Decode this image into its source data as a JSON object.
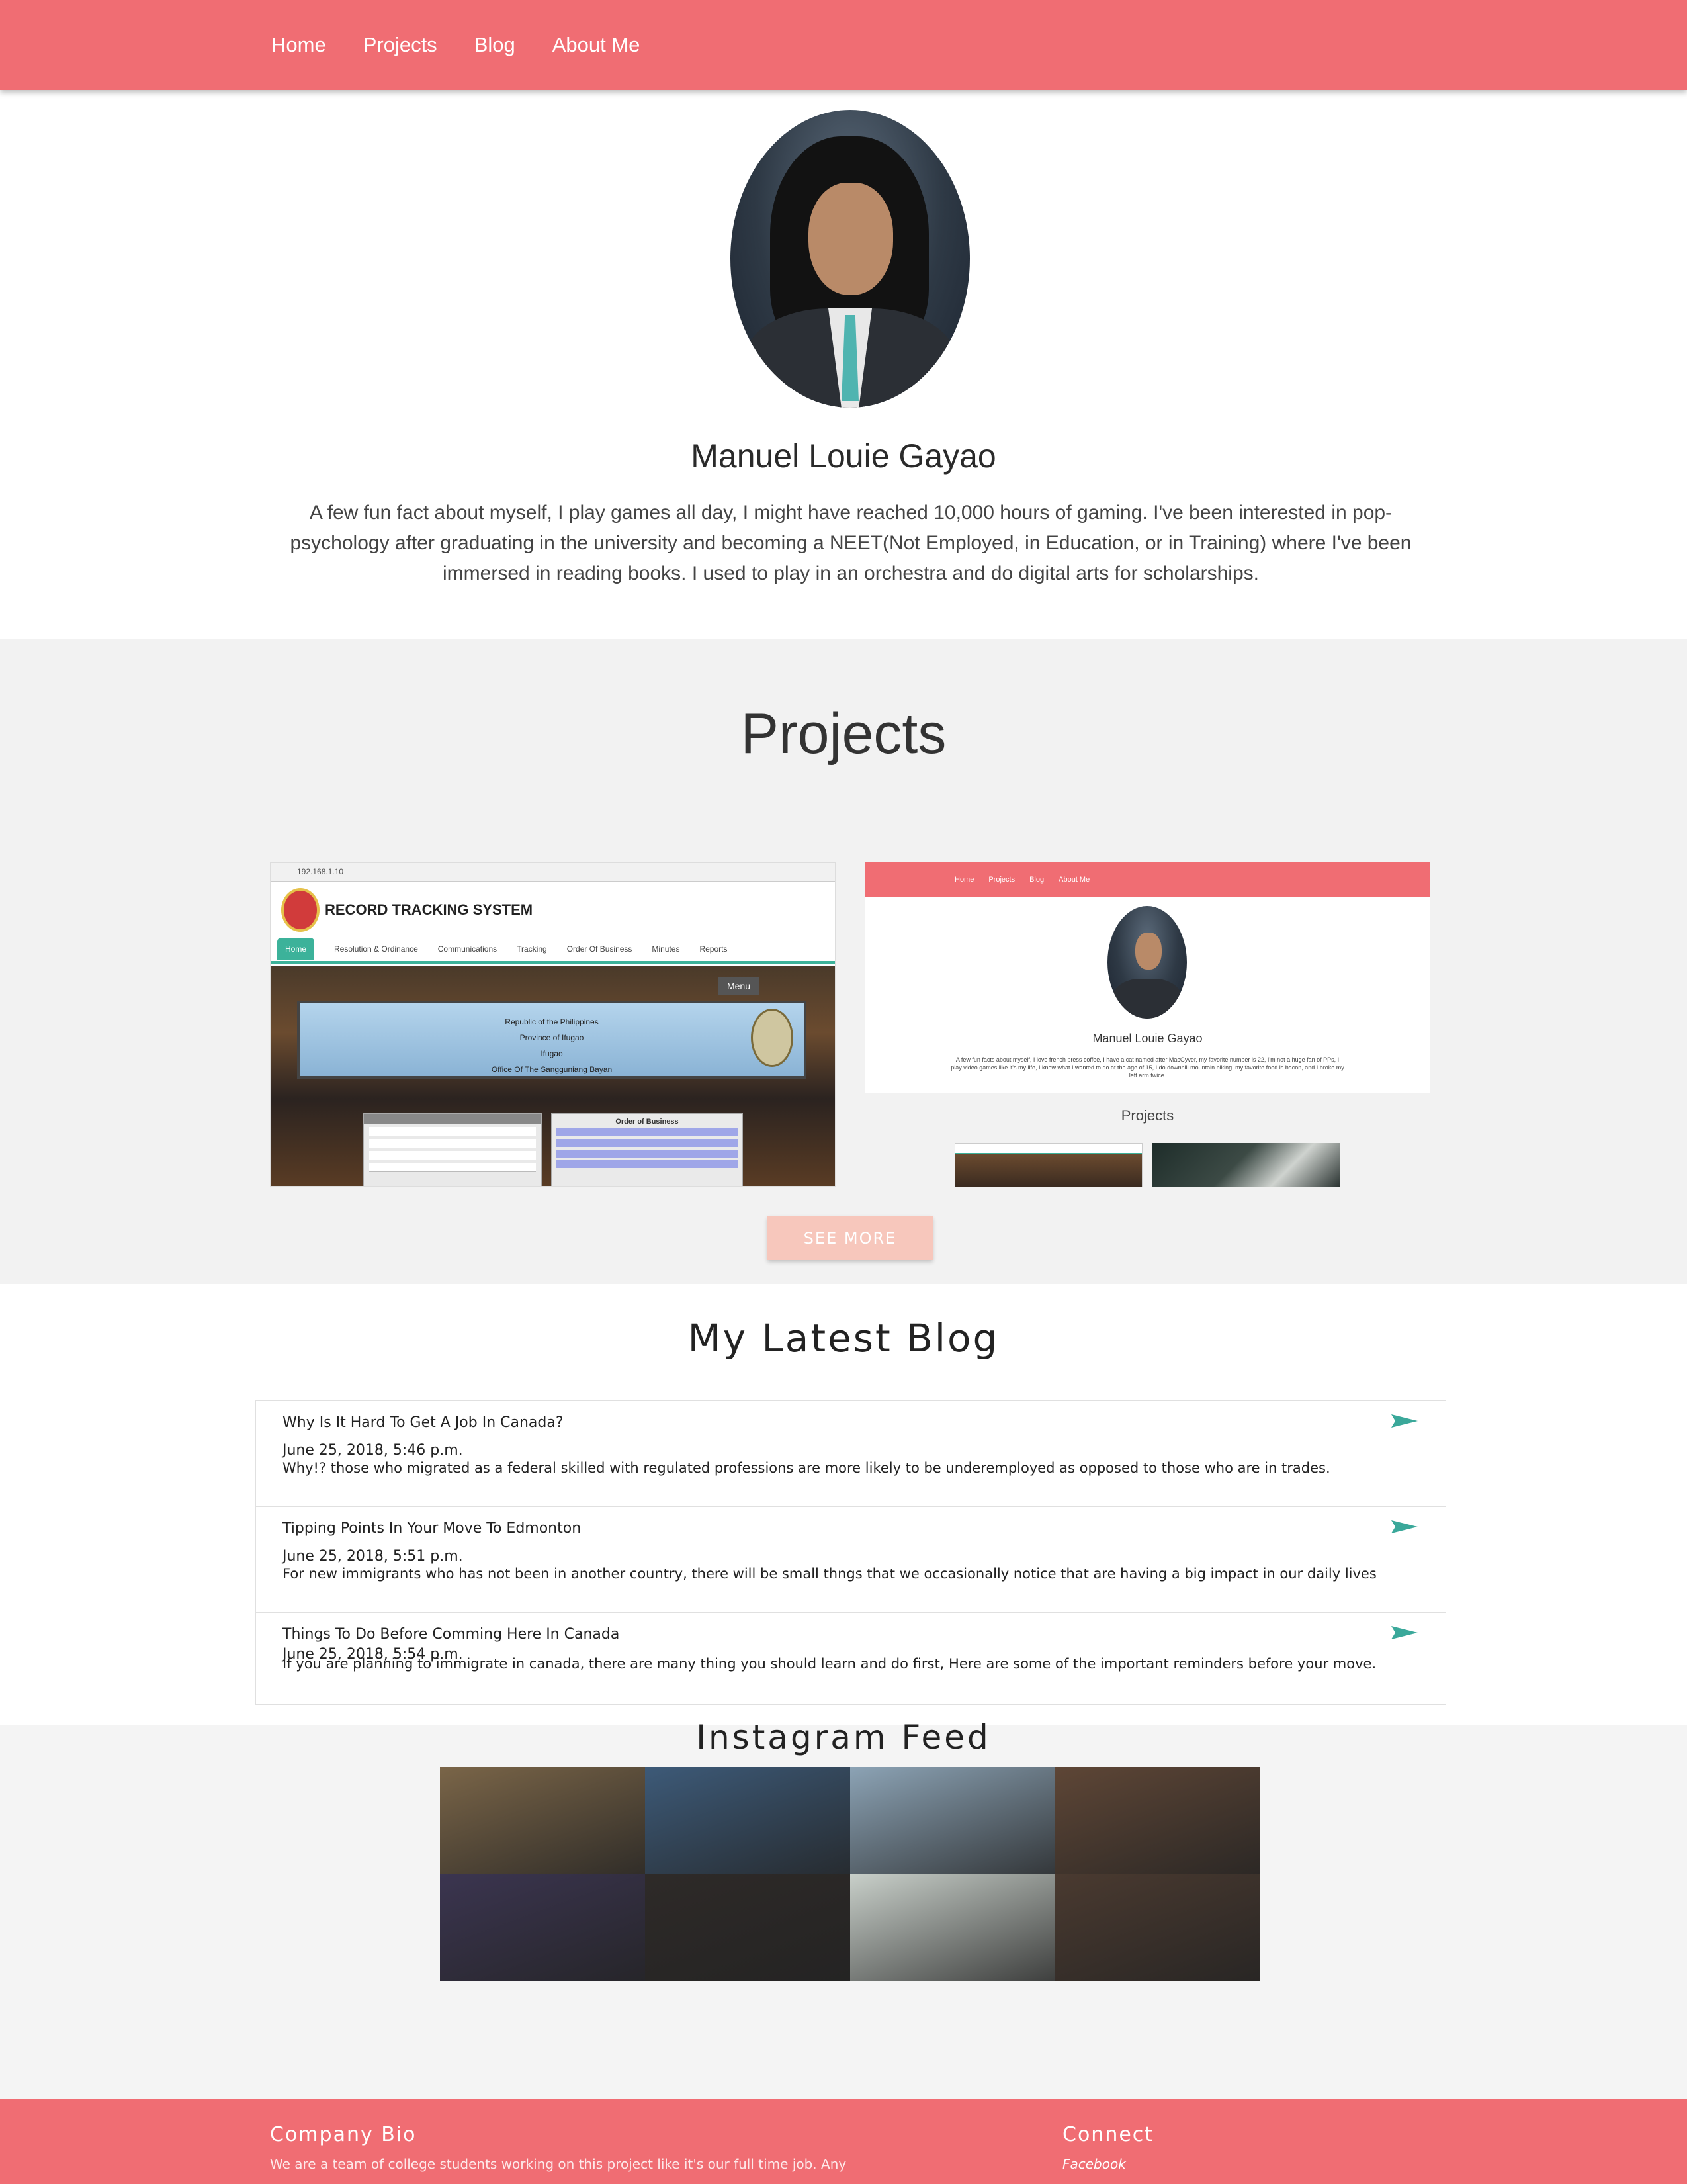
{
  "nav": {
    "items": [
      "Home",
      "Projects",
      "Blog",
      "About Me"
    ]
  },
  "profile": {
    "name": "Manuel Louie Gayao",
    "bio": "A few fun fact about myself, I play games all day, I might have reached 10,000 hours of gaming. I've been interested in pop-psychology after graduating in the university and becoming a NEET(Not Employed, in Education, or in Training) where I've been immersed in reading books. I used to play in an orchestra and do digital arts for scholarships."
  },
  "projects": {
    "title": "Projects",
    "card1": {
      "address": "192.168.1.10",
      "app_title": "RECORD TRACKING SYSTEM",
      "tabs": [
        "Home",
        "Resolution & Ordinance",
        "Communications",
        "Tracking",
        "Order Of Business",
        "Minutes",
        "Reports"
      ],
      "menu_label": "Menu",
      "banner_lines": [
        "Republic of the Philippines",
        "Province of Ifugao",
        "Ifugao",
        "Office Of The Sangguniang Bayan"
      ],
      "table_title": "Order of Business"
    },
    "card2": {
      "nav": [
        "Home",
        "Projects",
        "Blog",
        "About Me"
      ],
      "name": "Manuel Louie Gayao",
      "bio": "A few fun facts about myself, I love french press coffee, I have a cat named after MacGyver, my favorite number is 22, I'm not a huge fan of PPs, I play video games like it's my life, I knew what I wanted to do at the age of 15, I do downhill mountain biking, my favorite food is bacon, and I broke my left arm twice.",
      "section_label": "Projects"
    },
    "see_more": "SEE MORE"
  },
  "blog": {
    "title": "My Latest Blog",
    "posts": [
      {
        "title": "Why Is It Hard To Get A Job In Canada?",
        "date": "June 25, 2018, 5:46 p.m.",
        "excerpt": "Why!? those who migrated as a federal skilled with regulated professions are more likely to be underemployed as opposed to those who are in trades."
      },
      {
        "title": "Tipping Points In Your Move To Edmonton",
        "date": "June 25, 2018, 5:51 p.m.",
        "excerpt": "For new immigrants who has not been in another country, there will be small thngs that we occasionally notice that are having a big impact in our daily lives"
      },
      {
        "title": "Things To Do Before Comming Here In Canada",
        "date": "June 25, 2018, 5:54 p.m.",
        "excerpt": "If you are planning to immigrate in canada, there are many thing you should learn and do first, Here are some of the important reminders before your move."
      }
    ],
    "icon": "send-icon",
    "accent": "#3aa89a"
  },
  "instagram": {
    "title": "Instagram Feed",
    "photo_tones": [
      "#7a6548",
      "#3d5a78",
      "#8ca3b5",
      "#5e4636",
      "#3b3550",
      "#2e2a28",
      "#c8cfc9",
      "#4a3a30"
    ]
  },
  "footer": {
    "bio_heading": "Company Bio",
    "bio_text": "We are a team of college students working on this project like it's our full time job. Any",
    "connect_heading": "Connect",
    "connect_link": "Facebook"
  },
  "colors": {
    "brand": "#f06d73",
    "see_more": "#f7c7bc",
    "section_bg": "#f2f2f2"
  }
}
